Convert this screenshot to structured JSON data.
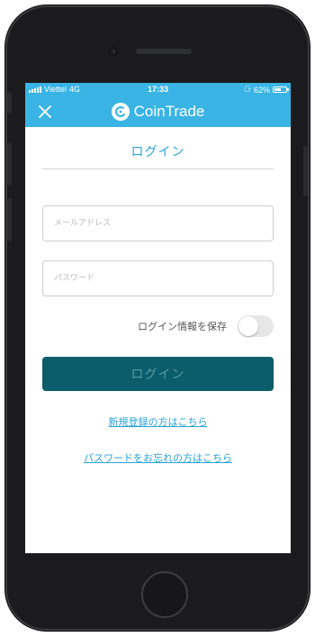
{
  "status_bar": {
    "carrier": "Viettel",
    "network": "4G",
    "time": "17:33",
    "battery_percent_label": "62%",
    "battery_level": 0.62
  },
  "header": {
    "app_name": "CoinTrade",
    "close_icon": "close-icon",
    "logo_icon": "cointrade-logo-icon"
  },
  "login": {
    "title": "ログイン",
    "email_placeholder": "メールアドレス",
    "email_value": "",
    "password_placeholder": "パスワード",
    "password_value": "",
    "remember_label": "ログイン情報を保存",
    "remember_enabled": false,
    "submit_label": "ログイン",
    "register_link": "新規登録の方はこちら",
    "forgot_link": "パスワードをお忘れの方はこちら"
  },
  "colors": {
    "accent": "#3ab4e4",
    "link": "#2aa3d8",
    "button": "#0b5d6b"
  }
}
